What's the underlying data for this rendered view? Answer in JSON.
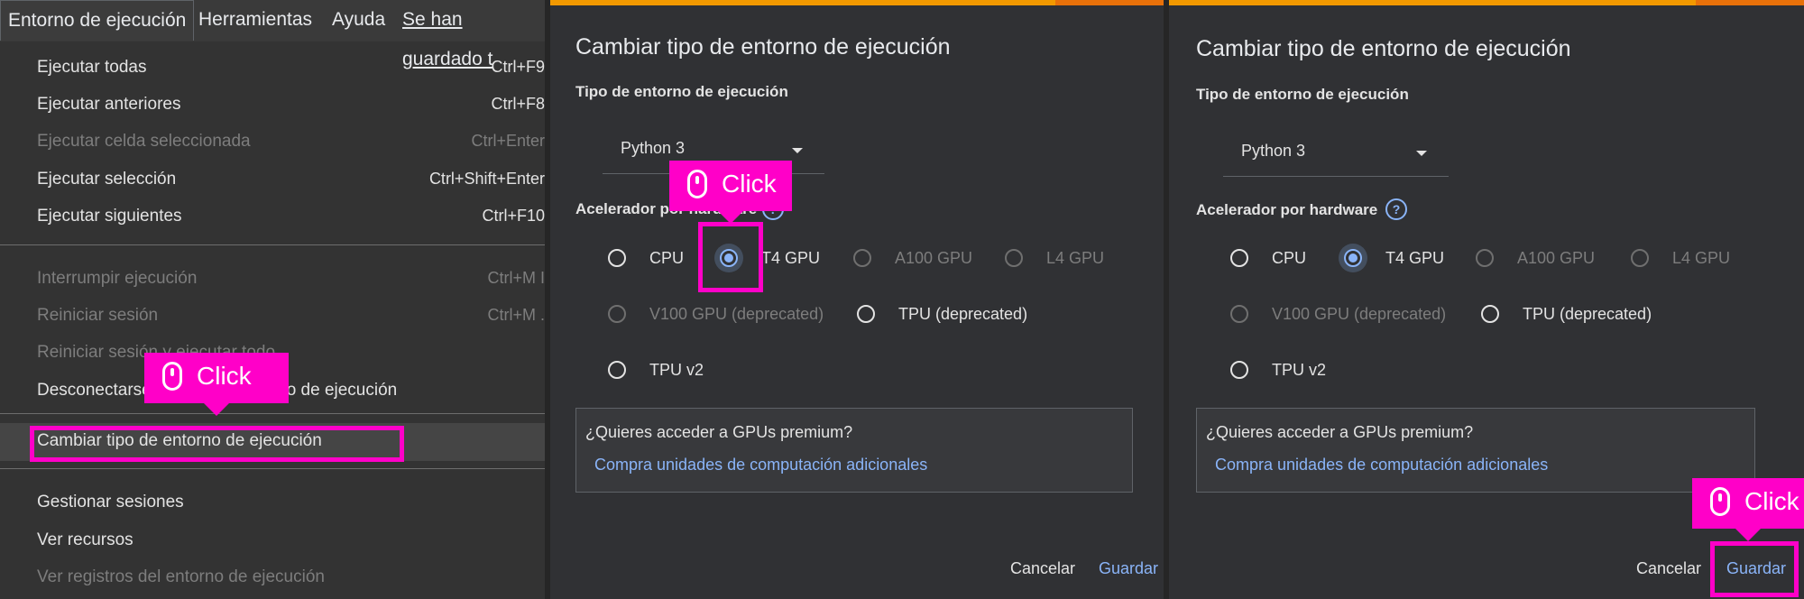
{
  "menubar": {
    "items": [
      "Entorno de ejecución",
      "Herramientas",
      "Ayuda"
    ],
    "saved_status": "Se han guardado t"
  },
  "runtime_menu": {
    "items": [
      {
        "label": "Ejecutar todas",
        "shortcut": "Ctrl+F9"
      },
      {
        "label": "Ejecutar anteriores",
        "shortcut": "Ctrl+F8"
      },
      {
        "label": "Ejecutar celda seleccionada",
        "shortcut": "Ctrl+Enter"
      },
      {
        "label": "Ejecutar selección",
        "shortcut": "Ctrl+Shift+Enter"
      },
      {
        "label": "Ejecutar siguientes",
        "shortcut": "Ctrl+F10"
      },
      {
        "label": "Interrumpir ejecución",
        "shortcut": "Ctrl+M I"
      },
      {
        "label": "Reiniciar sesión",
        "shortcut": "Ctrl+M ."
      },
      {
        "label": "Reiniciar sesión y ejecutar todo",
        "shortcut": ""
      },
      {
        "label": "Desconectarse y borrar el entorno de ejecución",
        "shortcut": ""
      },
      {
        "label": "Cambiar tipo de entorno de ejecución",
        "shortcut": ""
      },
      {
        "label": "Gestionar sesiones",
        "shortcut": ""
      },
      {
        "label": "Ver recursos",
        "shortcut": ""
      },
      {
        "label": "Ver registros del entorno de ejecución",
        "shortcut": ""
      }
    ]
  },
  "dialog": {
    "title": "Cambiar tipo de entorno de ejecución",
    "runtime_type_label": "Tipo de entorno de ejecución",
    "runtime_type_value": "Python 3",
    "accelerator_label": "Acelerador por hardware",
    "help_glyph": "?",
    "options": [
      "CPU",
      "T4 GPU",
      "A100 GPU",
      "L4 GPU",
      "V100 GPU (deprecated)",
      "TPU (deprecated)",
      "TPU v2"
    ],
    "selected_option": "T4 GPU",
    "premium_question": "¿Quieres acceder a GPUs premium?",
    "premium_link": "Compra unidades de computación adicionales",
    "cancel_label": "Cancelar",
    "save_label": "Guardar"
  },
  "annotations": {
    "click_label": "Click",
    "highlight_color": "#ff00c8"
  },
  "colors": {
    "accent": "#8ab4f8",
    "strip": "#f29900"
  }
}
